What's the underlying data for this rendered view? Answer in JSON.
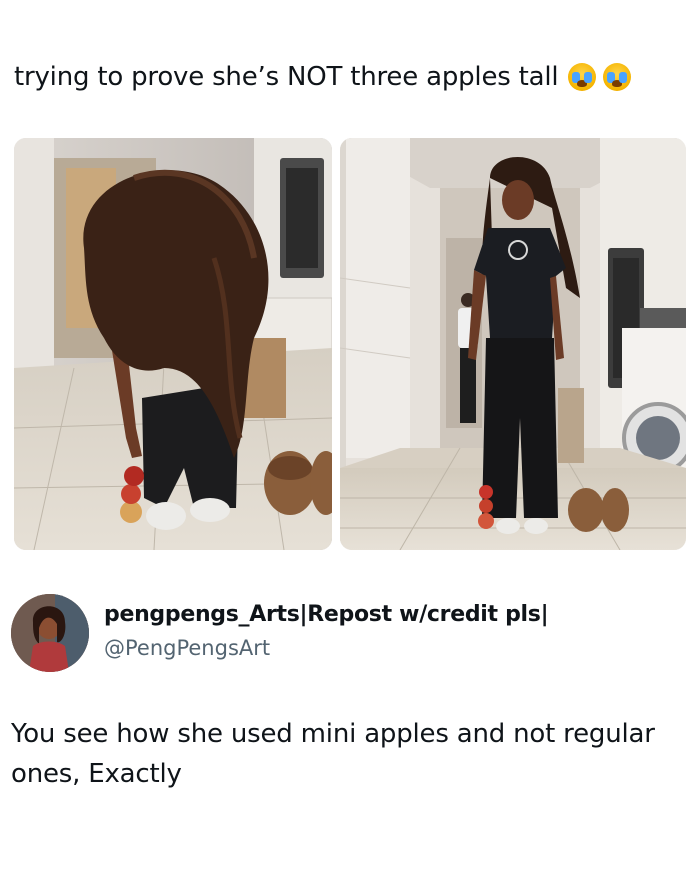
{
  "post": {
    "caption": "trying to prove she’s NOT three apples tall",
    "caption_emojis": [
      "loudly-crying-face-icon",
      "loudly-crying-face-icon"
    ]
  },
  "photos": [
    {
      "name": "photo-left"
    },
    {
      "name": "photo-right"
    }
  ],
  "author": {
    "display_name": "pengpengs_Arts|Repost w/credit pls|",
    "handle": "@PengPengsArt"
  },
  "comment": {
    "text": "You see how she used mini apples and not regular ones, Exactly"
  },
  "colors": {
    "text": "#0f1419",
    "secondary_text": "#536471",
    "background": "#ffffff"
  }
}
